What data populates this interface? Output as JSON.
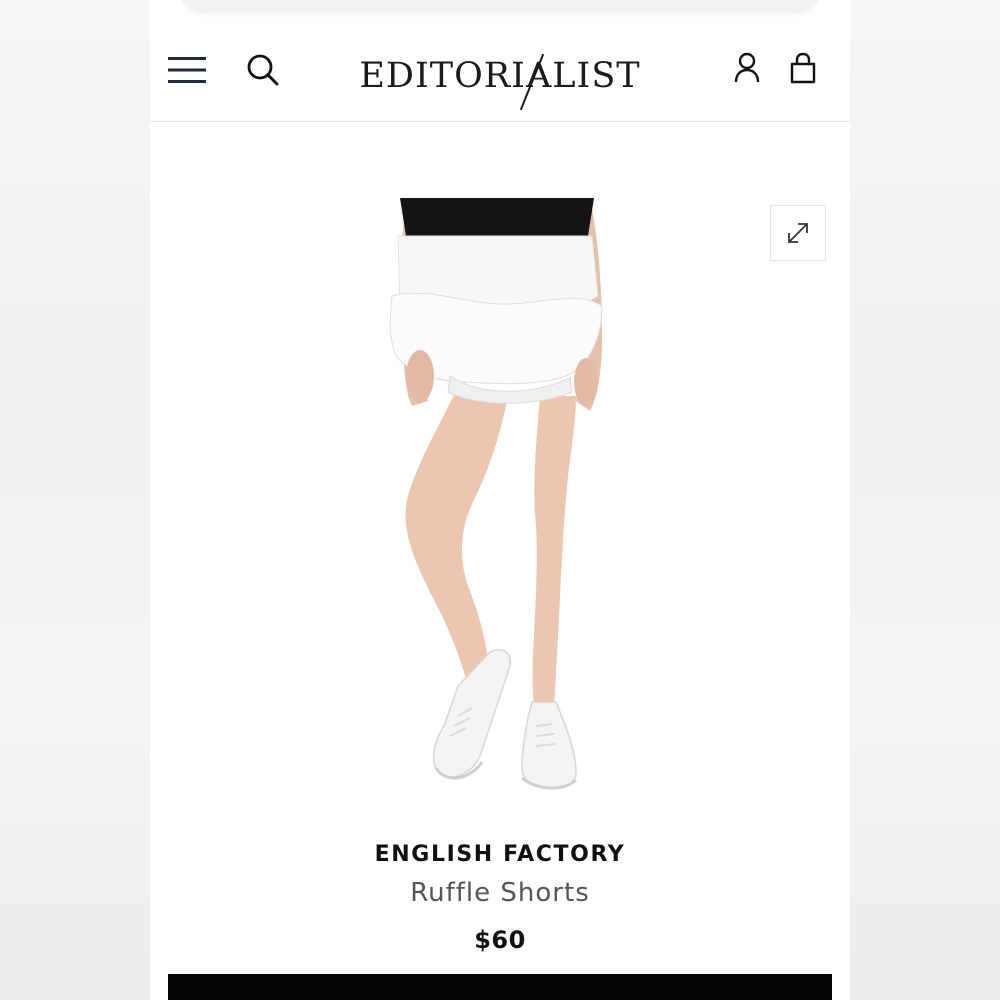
{
  "header": {
    "logo_text": "EDITORIALIST",
    "menu_icon": "hamburger-menu-icon",
    "search_icon": "search-icon",
    "account_icon": "user-icon",
    "bag_icon": "shopping-bag-icon"
  },
  "product": {
    "brand": "ENGLISH FACTORY",
    "name": "Ruffle Shorts",
    "price": "$60",
    "image_alt": "Model wearing white ruffle shorts with black top and white sneakers",
    "expand_icon": "expand-arrows-icon"
  },
  "colors": {
    "text_primary": "#111111",
    "text_secondary": "#555555",
    "nav_icon": "#1f2b3a",
    "button_bar": "#050505"
  }
}
